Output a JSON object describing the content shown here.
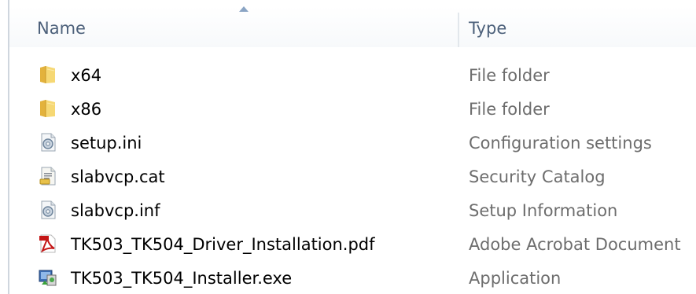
{
  "header": {
    "name_label": "Name",
    "type_label": "Type"
  },
  "files": [
    {
      "name": "x64",
      "type": "File folder",
      "icon": "folder-icon"
    },
    {
      "name": "x86",
      "type": "File folder",
      "icon": "folder-icon"
    },
    {
      "name": "setup.ini",
      "type": "Configuration settings",
      "icon": "settings-file-icon"
    },
    {
      "name": "slabvcp.cat",
      "type": "Security Catalog",
      "icon": "security-catalog-icon"
    },
    {
      "name": "slabvcp.inf",
      "type": "Setup Information",
      "icon": "settings-file-icon"
    },
    {
      "name": "TK503_TK504_Driver_Installation.pdf",
      "type": "Adobe Acrobat Document",
      "icon": "pdf-icon"
    },
    {
      "name": "TK503_TK504_Installer.exe",
      "type": "Application",
      "icon": "installer-icon"
    }
  ],
  "colors": {
    "header_text": "#4c607a",
    "type_text": "#6d6d6d",
    "folder": "#f4cf63"
  }
}
